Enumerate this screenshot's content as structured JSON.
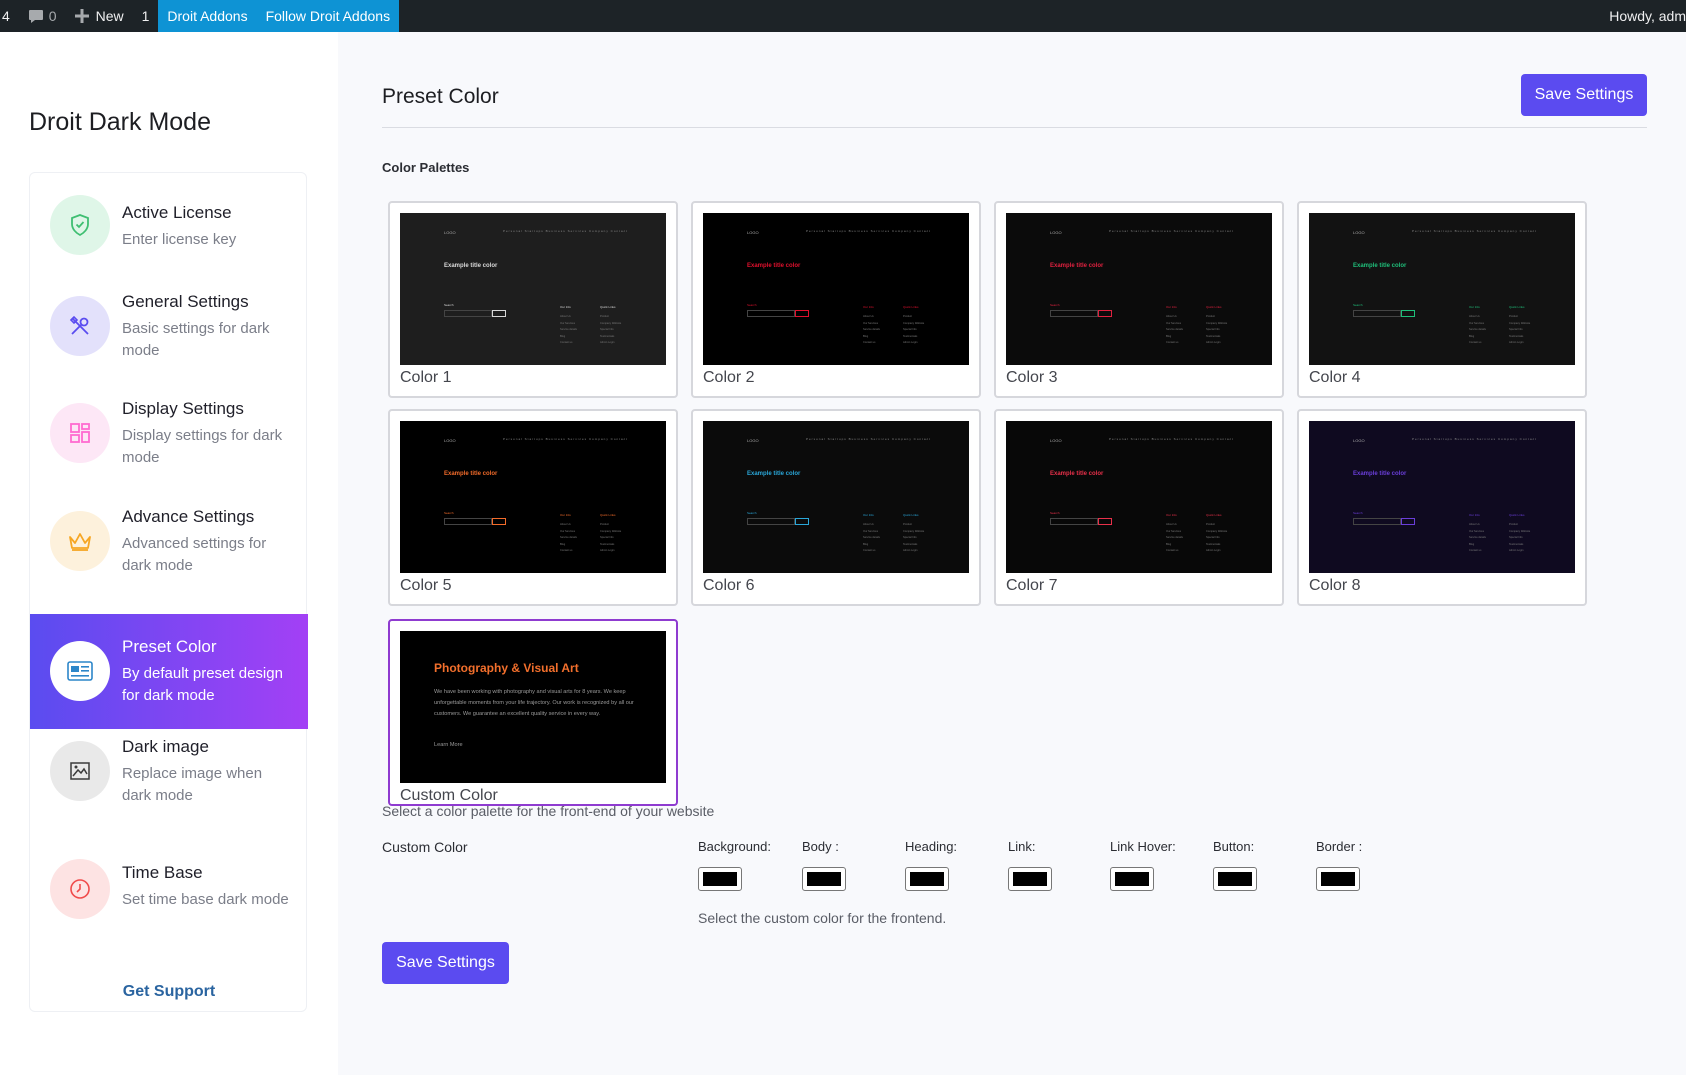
{
  "adminbar": {
    "updates_count": "4",
    "comments_count": "0",
    "new_label": "New",
    "notif_count": "1",
    "droit_addons": "Droit Addons",
    "follow_droit": "Follow Droit Addons",
    "howdy": "Howdy, adm"
  },
  "sidebar": {
    "brand": "Droit Dark Mode",
    "items": [
      {
        "title": "Active License",
        "desc": "Enter license key",
        "icon": "shield-check-icon",
        "color": "#3fbf72",
        "bg": "#dff6e8"
      },
      {
        "title": "General Settings",
        "desc": "Basic settings for dark mode",
        "icon": "tools-icon",
        "color": "#5a4cf0",
        "bg": "#e3e1fb"
      },
      {
        "title": "Display Settings",
        "desc": "Display settings for dark mode",
        "icon": "layout-grid-icon",
        "color": "#ff6bd0",
        "bg": "#fde7f6"
      },
      {
        "title": "Advance Settings",
        "desc": "Advanced settings for dark mode",
        "icon": "crown-icon",
        "color": "#f6a623",
        "bg": "#fdf1dc"
      },
      {
        "title": "Preset Color",
        "desc": "By default preset design for dark mode",
        "icon": "preset-card-icon",
        "color": "#2c86c9",
        "bg": "#ffffff"
      },
      {
        "title": "Dark image",
        "desc": "Replace image when dark mode",
        "icon": "image-icon",
        "color": "#3a3a3a",
        "bg": "#e9e9e9"
      },
      {
        "title": "Time Base",
        "desc": "Set time base dark mode",
        "icon": "clock-icon",
        "color": "#f04b4b",
        "bg": "#fde3e3"
      }
    ],
    "get_support": "Get Support"
  },
  "main": {
    "title": "Preset Color",
    "save_label": "Save Settings",
    "palettes_label": "Color Palettes",
    "palettes": [
      {
        "label": "Color 1",
        "bg": "#1e1e1e",
        "accent": "#d9d9d9"
      },
      {
        "label": "Color 2",
        "bg": "#000000",
        "accent": "#e0102d"
      },
      {
        "label": "Color 3",
        "bg": "#0b0b0b",
        "accent": "#e0213f"
      },
      {
        "label": "Color 4",
        "bg": "#121212",
        "accent": "#1fbf7a"
      },
      {
        "label": "Color 5",
        "bg": "#000000",
        "accent": "#f26b2a"
      },
      {
        "label": "Color 6",
        "bg": "#0b0b0b",
        "accent": "#2aa7d9"
      },
      {
        "label": "Color 7",
        "bg": "#080808",
        "accent": "#e8304a"
      },
      {
        "label": "Color 8",
        "bg": "#0f0a20",
        "accent": "#6a3ed9"
      }
    ],
    "preview_text": {
      "logo": "LOGO",
      "nav": "Personal  Startups  Business  Services  Company  Contact",
      "title": "Example title color",
      "search": "Search",
      "col1": "Our Info",
      "col2": "Quick Links",
      "col1_lines": [
        "About Us",
        "Our Services",
        "Service details",
        "Blog",
        "Contact us"
      ],
      "col2_lines": [
        "Product",
        "Company Website",
        "Special Info",
        "Testimonials",
        "Admin Login"
      ]
    },
    "custom": {
      "label": "Custom Color",
      "title": "Photography & Visual Art",
      "body": "We have been working with photography and visual arts for 8 years. We keep unforgettable moments from your life trajectory. Our work is recognized by all our customers. We guarantee an excellent quality service in every way.",
      "more": "Learn More"
    },
    "hint_palette": "Select a color palette for the front-end of your website",
    "custom_color_label": "Custom Color",
    "fields": [
      {
        "label": "Background:",
        "value": "#000000"
      },
      {
        "label": "Body :",
        "value": "#000000"
      },
      {
        "label": "Heading:",
        "value": "#000000"
      },
      {
        "label": "Link:",
        "value": "#000000"
      },
      {
        "label": "Link Hover:",
        "value": "#000000"
      },
      {
        "label": "Button:",
        "value": "#000000"
      },
      {
        "label": "Border :",
        "value": "#000000"
      }
    ],
    "hint_custom": "Select the custom color for the frontend."
  }
}
